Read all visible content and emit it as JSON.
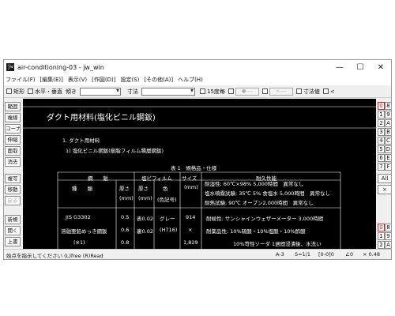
{
  "window": {
    "title": "air-conditioning-03 - jw_win",
    "app_icon": "jw"
  },
  "menu": [
    "ファイル(F)",
    "[編集(E)]",
    "表示(V)",
    "[作図(D)]",
    "設定(S)",
    "[その他(A)]",
    "ヘルプ(H)"
  ],
  "toolbar": {
    "rect_label": "矩形",
    "hv_label": "水平・垂直",
    "tilt_label": "傾き",
    "dim_label": "寸法",
    "deg15_label": "15度毎",
    "box1": "●----",
    "box2": "<----",
    "dimval_label": "寸法値",
    "last_label": "<"
  },
  "left_buttons": [
    "範囲",
    "複線",
    "コーナー",
    "伸縮",
    "面取",
    "消去",
    "複写",
    "移動",
    "戻る",
    "新規",
    "開く",
    "上書"
  ],
  "right_buttons": {
    "rows": [
      [
        "0",
        "8"
      ],
      [
        "1",
        "9"
      ],
      [
        "2",
        "A"
      ],
      [
        "3",
        "B"
      ],
      [
        "4",
        "C"
      ],
      [
        "5",
        "D"
      ],
      [
        "6",
        "E"
      ],
      [
        "7",
        "F"
      ]
    ],
    "all": "All",
    "x": "×",
    "bottom": [
      [
        "0",
        "8"
      ],
      [
        "1",
        "9"
      ],
      [
        "2",
        "A"
      ]
    ]
  },
  "document": {
    "heading": "ダクト用材料(塩化ビニル鋼鈑)",
    "section": "1. ダクト用材料",
    "subsection": "1) 塩化ビニル鋼鈑(樹脂フィルム積層鋼鈑)",
    "table_title": "表 1　規格品・仕様",
    "header1": [
      "鋼　　鈑",
      "塩ビフィルム",
      "サイズ",
      "耐久性能"
    ],
    "header2": [
      "種　　類",
      "厚さ",
      "厚さ",
      "色",
      "(mm)"
    ],
    "header3": [
      "(mm)",
      "(mm)",
      "(色記号)"
    ],
    "perf_lines": [
      "耐湿性: 60℃×98% 5,000時間　異常なし",
      "塩水噴霧試験: 35℃ 5% 食塩水 5,000時間　異常なし",
      "耐熱試験: 90℃ オーブン2,000時間　異常なし"
    ],
    "rows": [
      {
        "kind": "JIS G3302",
        "t": "0.5",
        "ft": "表0.02",
        "color": "グレー",
        "size": "914"
      },
      {
        "kind": "溶融亜鉛めっき鋼鈑",
        "t": "0.6",
        "ft": "裏0.02",
        "color": "(H716)",
        "size": "×"
      },
      {
        "kind": "(※1)",
        "t": "0.8",
        "ft": "",
        "color": "",
        "size": "1,829"
      }
    ],
    "perf2": [
      "耐候性: サンシャインウェザーメーター 3,000時間",
      "耐薬品性: 10%硫酸・10%塩酸・10%酢酸",
      "10%苛性ソーダ 1週間浸漬後、水洗い"
    ]
  },
  "status": {
    "message": "始点を指示してください (L)free (R)Read",
    "paper": "A-3",
    "scale": "S=1/1",
    "layer": "[0-0]0",
    "angle": "∠0",
    "zoom": "× 0.48"
  }
}
